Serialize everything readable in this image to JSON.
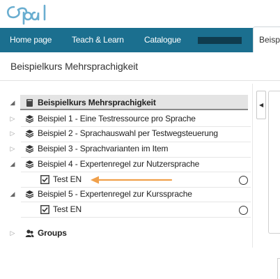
{
  "brand": {
    "logo_text": "Opal",
    "logo_color": "#6aaed0"
  },
  "nav": {
    "items": [
      {
        "label": "Home page"
      },
      {
        "label": "Teach & Learn"
      },
      {
        "label": "Catalogue"
      }
    ],
    "active_tab_label": "Beisp",
    "bar_color": "#1b6f8f"
  },
  "course": {
    "title": "Beispielkurs Mehrsprachigkeit"
  },
  "tree": {
    "root": {
      "label": "Beispielkurs Mehrsprachigkeit",
      "expanded": true
    },
    "nodes": [
      {
        "label": "Beispiel 1 - Eine Testressource pro Sprache",
        "expanded": false
      },
      {
        "label": "Beispiel 2 - Sprachauswahl per Testwegsteuerung",
        "expanded": false
      },
      {
        "label": "Beispiel 3 - Sprachvarianten im Item",
        "expanded": false
      },
      {
        "label": "Beispiel 4 - Expertenregel zur Nutzersprache",
        "expanded": true,
        "children": [
          {
            "label": "Test EN",
            "status": "not-started"
          }
        ]
      },
      {
        "label": "Beispiel 5 - Expertenregel zur Kurssprache",
        "expanded": true,
        "children": [
          {
            "label": "Test EN",
            "status": "not-started"
          }
        ]
      }
    ],
    "groups": {
      "label": "Groups"
    }
  },
  "annotation": {
    "arrow_color": "#f0a04b"
  }
}
